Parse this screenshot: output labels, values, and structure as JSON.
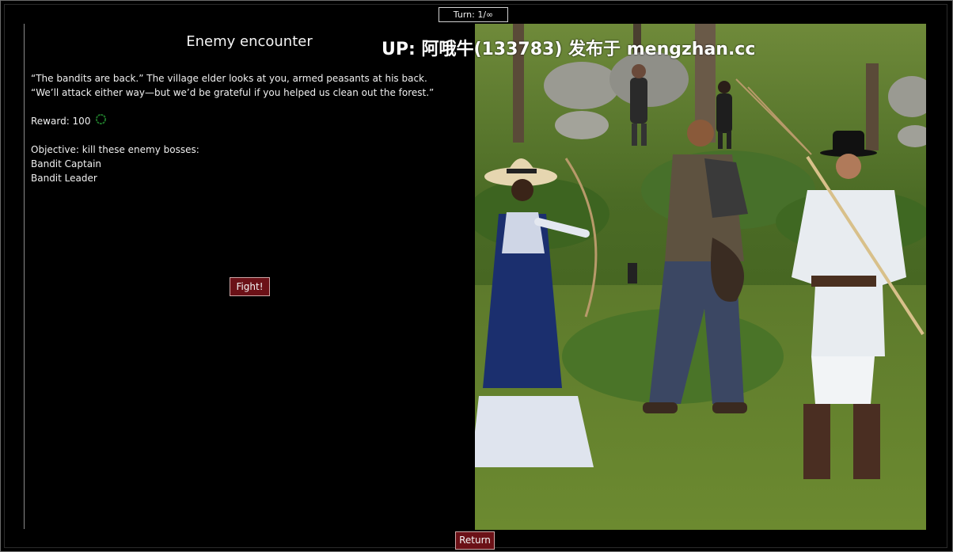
{
  "hud": {
    "turn": "Turn: 1/∞"
  },
  "encounter": {
    "title": "Enemy encounter",
    "story_line1": "“The bandits are back.” The village elder looks at you, armed peasants at his back.",
    "story_line2": "“We’ll attack either way—but we’d be grateful if you helped us clean out the forest.”",
    "reward_label": "Reward: 100",
    "objective_label": "Objective: kill these enemy bosses:",
    "bosses": [
      "Bandit Captain",
      "Bandit Leader"
    ],
    "fight_label": "Fight!"
  },
  "footer": {
    "return_label": "Return"
  },
  "watermark": "UP: 阿哦牛(133783) 发布于 mengzhan.cc",
  "colors": {
    "button_bg": "#6b1117",
    "reward_icon": "#1f7a2a"
  },
  "icons": {
    "reward": "coin-ring-icon"
  }
}
